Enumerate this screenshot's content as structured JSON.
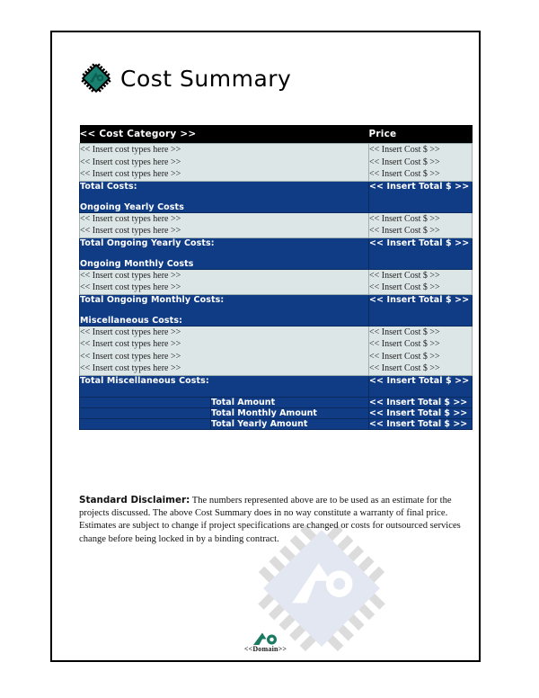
{
  "document": {
    "title": "Cost Summary",
    "logo_icon": "chip-diamond-icon",
    "watermark_icon": "chip-diamond-watermark"
  },
  "table": {
    "header": {
      "category": "<< Cost Category >>",
      "price": "Price"
    },
    "placeholders": {
      "cost_type": "<< Insert cost types here >>",
      "cost_amount": "<< Insert Cost $ >>",
      "total_amount": "<< Insert Total $ >>"
    },
    "sections": [
      {
        "id": "initial-costs",
        "line_items": [
          {
            "label": "<< Insert cost types here >>",
            "price": "<< Insert Cost $ >>"
          },
          {
            "label": "<< Insert cost types here >>",
            "price": "<< Insert Cost $ >>"
          },
          {
            "label": "<< Insert cost types here >>",
            "price": "<< Insert Cost $ >>"
          }
        ],
        "total_label": "Total Costs:",
        "total_value": "<< Insert Total $ >>",
        "next_heading": "Ongoing Yearly Costs"
      },
      {
        "id": "ongoing-yearly-costs",
        "line_items": [
          {
            "label": "<< Insert cost types here >>",
            "price": "<< Insert Cost $ >>"
          },
          {
            "label": "<< Insert cost types here >>",
            "price": "<< Insert Cost $ >>"
          }
        ],
        "total_label": "Total Ongoing Yearly Costs:",
        "total_value": "<< Insert Total $ >>",
        "next_heading": "Ongoing Monthly Costs"
      },
      {
        "id": "ongoing-monthly-costs",
        "line_items": [
          {
            "label": "<< Insert cost types here >>",
            "price": "<< Insert Cost $ >>"
          },
          {
            "label": "<< Insert cost types here >>",
            "price": "<< Insert Cost $ >>"
          }
        ],
        "total_label": "Total Ongoing Monthly Costs:",
        "total_value": "<< Insert Total $ >>",
        "next_heading": "Miscellaneous Costs:"
      },
      {
        "id": "miscellaneous-costs",
        "line_items": [
          {
            "label": "<< Insert cost types here >>",
            "price": "<< Insert Cost $ >>"
          },
          {
            "label": "<< Insert cost types here >>",
            "price": "<< Insert Cost $ >>"
          },
          {
            "label": "<< Insert cost types here >>",
            "price": "<< Insert Cost $ >>"
          },
          {
            "label": "<< Insert cost types here >>",
            "price": "<< Insert Cost $ >>"
          }
        ],
        "total_label": "Total Miscellaneous Costs:",
        "total_value": "<< Insert Total $ >>",
        "next_heading": ""
      }
    ],
    "grand_totals": [
      {
        "label": "Total Amount",
        "value": "<< Insert Total $ >>"
      },
      {
        "label": "Total Monthly Amount",
        "value": "<< Insert Total $ >>"
      },
      {
        "label": "Total Yearly Amount",
        "value": "<< Insert Total $ >>"
      }
    ]
  },
  "disclaimer": {
    "lead": "Standard Disclaimer:",
    "body": " The numbers represented above are to be used as an estimate for the projects discussed. The above Cost Summary does in no way constitute a warranty of final price. Estimates are subject to change if project specifications are changed or costs for outsourced services change before being locked in by a binding contract."
  },
  "footer": {
    "domain": "<<Domain>>",
    "mark_icon": "domain-arrow-circle-icon"
  },
  "colors": {
    "navy": "#103c85",
    "navy_border": "#0a2a5e",
    "light_row": "#dce6e6",
    "light_row_border": "#9fb0b0",
    "header_black": "#000000",
    "logo_teal": "#18806f",
    "logo_teal_dark": "#0d5f52",
    "watermark_blue": "#dfe5ef",
    "watermark_gray": "#dcdcdc",
    "footer_teal": "#1a7a62"
  }
}
